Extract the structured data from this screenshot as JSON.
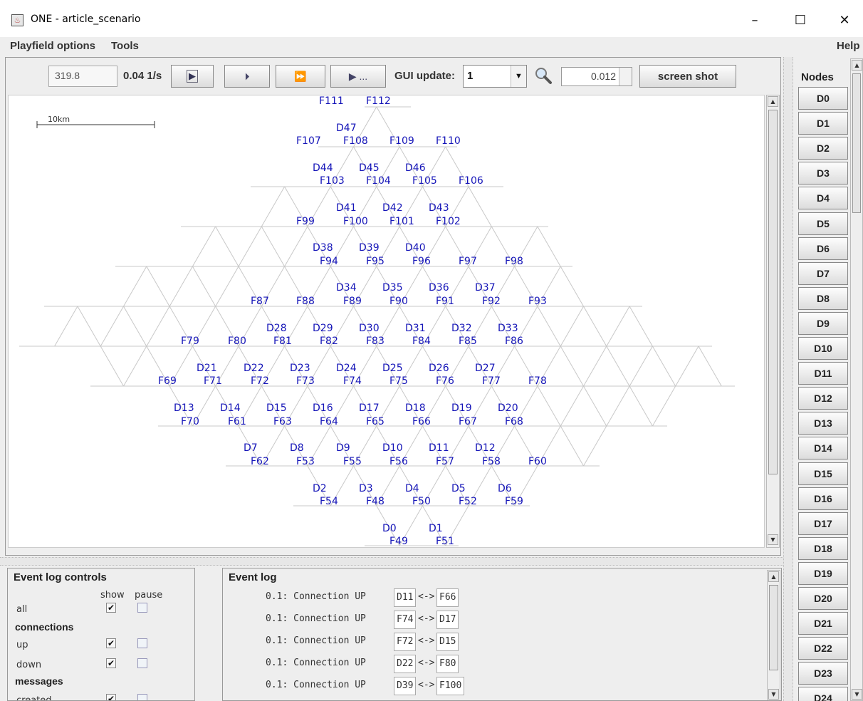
{
  "window": {
    "title": "ONE - article_scenario",
    "minimize": "–",
    "maximize": "☐",
    "close": "✕"
  },
  "menubar": {
    "left": [
      "Playfield options",
      "Tools"
    ],
    "right": "Help"
  },
  "toolbar": {
    "sim_time": "319.8",
    "speed": "0.04 1/s",
    "gui_update_label": "GUI update:",
    "gui_update_value": "1",
    "zoom_value": "0.012",
    "screenshot_label": "screen shot",
    "play_button": "▶",
    "step_button": "⏵",
    "ffw_button": "⏩",
    "play_until_button": "▶ ..."
  },
  "playfield": {
    "scale_label": "10km",
    "label_color": "#1515b8",
    "line_color": "#c8c8c8"
  },
  "nodes_panel": {
    "title": "Nodes",
    "nodes": [
      "D0",
      "D1",
      "D2",
      "D3",
      "D4",
      "D5",
      "D6",
      "D7",
      "D8",
      "D9",
      "D10",
      "D11",
      "D12",
      "D13",
      "D14",
      "D15",
      "D16",
      "D17",
      "D18",
      "D19",
      "D20",
      "D21",
      "D22",
      "D23",
      "D24"
    ]
  },
  "event_log_controls": {
    "title": "Event log controls",
    "col_show": "show",
    "col_pause": "pause",
    "rows": [
      {
        "kind": "option",
        "label": "all",
        "show": true,
        "pause": false
      },
      {
        "kind": "group",
        "label": "connections"
      },
      {
        "kind": "option",
        "label": "up",
        "show": true,
        "pause": false
      },
      {
        "kind": "option",
        "label": "down",
        "show": true,
        "pause": false
      },
      {
        "kind": "group",
        "label": "messages"
      },
      {
        "kind": "option",
        "label": "created",
        "show": true,
        "pause": false
      }
    ]
  },
  "event_log": {
    "title": "Event log",
    "entries": [
      {
        "text": "0.1: Connection UP",
        "a": "D11",
        "arrow": "<->",
        "b": "F66"
      },
      {
        "text": "0.1: Connection UP",
        "a": "F74",
        "arrow": "<->",
        "b": "D17"
      },
      {
        "text": "0.1: Connection UP",
        "a": "F72",
        "arrow": "<->",
        "b": "D15"
      },
      {
        "text": "0.1: Connection UP",
        "a": "D22",
        "arrow": "<->",
        "b": "F80"
      },
      {
        "text": "0.1: Connection UP",
        "a": "D39",
        "arrow": "<->",
        "b": "F100"
      }
    ]
  }
}
